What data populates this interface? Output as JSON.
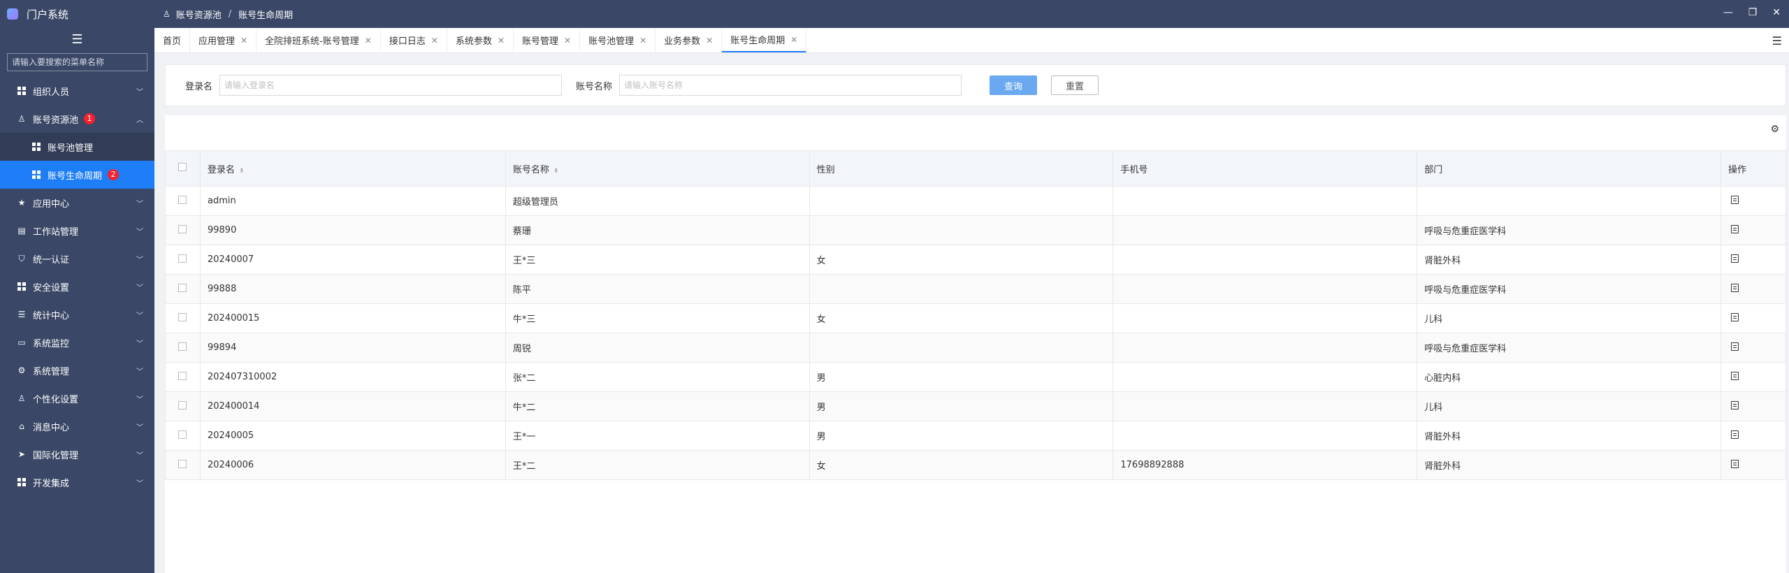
{
  "app": {
    "title": "门户系统"
  },
  "sidebar": {
    "search_placeholder": "请输入要搜索的菜单名称",
    "items": [
      {
        "label": "组织人员",
        "icon": "grid-icon"
      },
      {
        "label": "账号资源池",
        "icon": "user-icon",
        "badge": "1",
        "children": [
          {
            "label": "账号池管理",
            "icon": "grid-icon"
          },
          {
            "label": "账号生命周期",
            "icon": "grid-icon",
            "badge": "2",
            "active": true
          }
        ]
      },
      {
        "label": "应用中心",
        "icon": "star-icon"
      },
      {
        "label": "工作站管理",
        "icon": "server-icon"
      },
      {
        "label": "统一认证",
        "icon": "shield-icon"
      },
      {
        "label": "安全设置",
        "icon": "grid-icon"
      },
      {
        "label": "统计中心",
        "icon": "list-icon"
      },
      {
        "label": "系统监控",
        "icon": "monitor-icon"
      },
      {
        "label": "系统管理",
        "icon": "gear-icon"
      },
      {
        "label": "个性化设置",
        "icon": "user-gear-icon"
      },
      {
        "label": "消息中心",
        "icon": "home-icon"
      },
      {
        "label": "国际化管理",
        "icon": "send-icon"
      },
      {
        "label": "开发集成",
        "icon": "grid-icon"
      }
    ]
  },
  "topbar": {
    "breadcrumb": [
      "账号资源池",
      "账号生命周期"
    ],
    "window_controls": [
      "—",
      "❐",
      "✕"
    ]
  },
  "tabs": [
    {
      "label": "首页",
      "closable": false
    },
    {
      "label": "应用管理",
      "closable": true
    },
    {
      "label": "全院排班系统-账号管理",
      "closable": true
    },
    {
      "label": "接口日志",
      "closable": true
    },
    {
      "label": "系统参数",
      "closable": true
    },
    {
      "label": "账号管理",
      "closable": true
    },
    {
      "label": "账号池管理",
      "closable": true
    },
    {
      "label": "业务参数",
      "closable": true
    },
    {
      "label": "账号生命周期",
      "closable": true,
      "active": true
    }
  ],
  "filter": {
    "login_label": "登录名",
    "login_placeholder": "请输入登录名",
    "account_label": "账号名称",
    "account_placeholder": "请输入账号名称",
    "query_button": "查询",
    "reset_button": "重置"
  },
  "table": {
    "columns": [
      "登录名",
      "账号名称",
      "性别",
      "手机号",
      "部门",
      "操作"
    ],
    "rows": [
      {
        "login": "admin",
        "name": "超级管理员",
        "gender": "",
        "phone": "",
        "dept": ""
      },
      {
        "login": "99890",
        "name": "蔡珊",
        "gender": "",
        "phone": "",
        "dept": "呼吸与危重症医学科"
      },
      {
        "login": "20240007",
        "name": "王*三",
        "gender": "女",
        "phone": "",
        "dept": "肾脏外科"
      },
      {
        "login": "99888",
        "name": "陈平",
        "gender": "",
        "phone": "",
        "dept": "呼吸与危重症医学科"
      },
      {
        "login": "202400015",
        "name": "牛*三",
        "gender": "女",
        "phone": "",
        "dept": "儿科"
      },
      {
        "login": "99894",
        "name": "周锐",
        "gender": "",
        "phone": "",
        "dept": "呼吸与危重症医学科"
      },
      {
        "login": "202407310002",
        "name": "张*二",
        "gender": "男",
        "phone": "",
        "dept": "心脏内科"
      },
      {
        "login": "202400014",
        "name": "牛*二",
        "gender": "男",
        "phone": "",
        "dept": "儿科"
      },
      {
        "login": "20240005",
        "name": "王*一",
        "gender": "男",
        "phone": "",
        "dept": "肾脏外科"
      },
      {
        "login": "20240006",
        "name": "王*二",
        "gender": "女",
        "phone": "17698892888",
        "dept": "肾脏外科"
      }
    ]
  },
  "colors": {
    "sidebar": "#3a4766",
    "active": "#1e7ef7",
    "badge": "#f5222d",
    "query_button": "#6aa8ef"
  }
}
